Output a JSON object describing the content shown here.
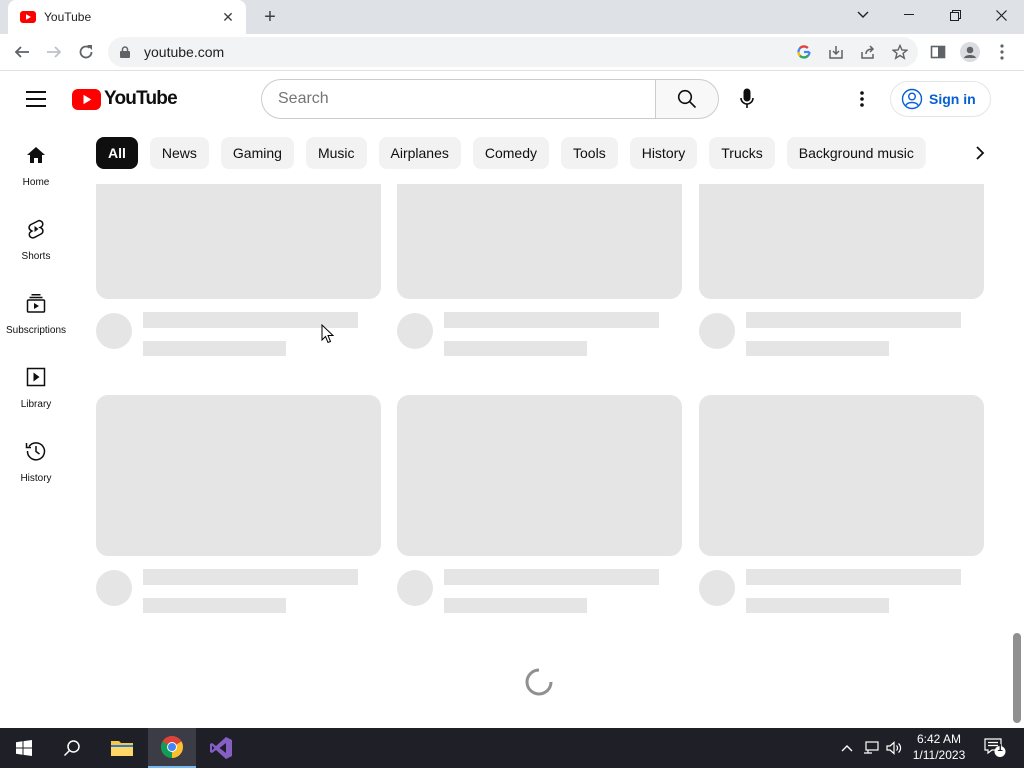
{
  "browser": {
    "tab_title": "YouTube",
    "tab_close": "✕",
    "new_tab": "+",
    "url": "youtube.com"
  },
  "masthead": {
    "logo_text": "YouTube",
    "search_placeholder": "Search",
    "signin_label": "Sign in"
  },
  "chips": [
    "All",
    "News",
    "Gaming",
    "Music",
    "Airplanes",
    "Comedy",
    "Tools",
    "History",
    "Trucks",
    "Background music"
  ],
  "guide": [
    {
      "label": "Home",
      "icon": "home-icon"
    },
    {
      "label": "Shorts",
      "icon": "shorts-icon"
    },
    {
      "label": "Subscriptions",
      "icon": "subscriptions-icon"
    },
    {
      "label": "Library",
      "icon": "library-icon"
    },
    {
      "label": "History",
      "icon": "history-icon"
    }
  ],
  "grid": {
    "placeholder_cards": 6,
    "state": "loading"
  },
  "taskbar": {
    "time": "6:42 AM",
    "date": "1/11/2023",
    "notifications": "1"
  },
  "colors": {
    "brand_red": "#ff0000",
    "link_blue": "#065fd4",
    "skeleton": "#e5e5e5",
    "chip_bg": "#f2f2f2",
    "taskbar_bg": "#1f1f28"
  }
}
